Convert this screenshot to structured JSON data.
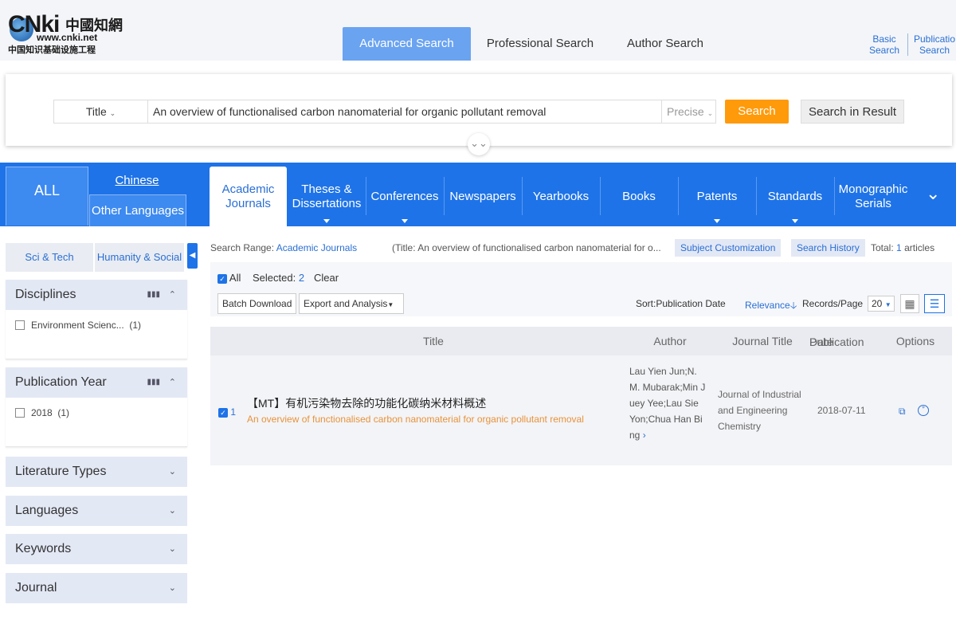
{
  "logo": {
    "brand": "CNki",
    "cn": "中國知網",
    "url": "www.cnki.net",
    "sub": "中国知识基础设施工程"
  },
  "search_tabs": [
    "Advanced Search",
    "Professional Search",
    "Author Search"
  ],
  "quick_links": [
    {
      "line1": "Basic",
      "line2": "Search"
    },
    {
      "line1": "Publicatio",
      "line2": "Search"
    }
  ],
  "search": {
    "field_type": "Title",
    "query": "An overview of functionalised carbon nanomaterial for organic pollutant removal",
    "match_mode": "Precise",
    "search_label": "Search",
    "search_in_result_label": "Search in Result"
  },
  "nav": {
    "all_label": "ALL",
    "chinese_label": "Chinese",
    "other_label": "Other Languages",
    "tabs": [
      {
        "line1": "Academic",
        "line2": "Journals"
      },
      {
        "line1": "Theses &",
        "line2": "Dissertations"
      },
      {
        "line1": "Conferences",
        "line2": ""
      },
      {
        "line1": "Newspapers",
        "line2": ""
      },
      {
        "line1": "Yearbooks",
        "line2": ""
      },
      {
        "line1": "Books",
        "line2": ""
      },
      {
        "line1": "Patents",
        "line2": ""
      },
      {
        "line1": "Standards",
        "line2": ""
      },
      {
        "line1": "Monographic",
        "line2": "Serials"
      }
    ]
  },
  "sidebar": {
    "segments": [
      "Sci & Tech",
      "Humanity & Social"
    ],
    "disciplines": {
      "title": "Disciplines",
      "items": [
        {
          "label": "Environment Scienc...",
          "count": "(1)"
        }
      ]
    },
    "pub_year": {
      "title": "Publication Year",
      "items": [
        {
          "label": "2018",
          "count": "(1)"
        }
      ]
    },
    "groups": [
      "Literature Types",
      "Languages",
      "Keywords",
      "Journal"
    ]
  },
  "results": {
    "range_label": "Search Range:",
    "range_value": "Academic Journals",
    "query_summary": "(Title:  An overview of functionalised carbon nanomaterial for o...",
    "subject_custom": "Subject Customization",
    "search_history": "Search History",
    "total_label": "Total:",
    "total_count": "1",
    "articles_label": "articles",
    "all_label": "All",
    "selected_label": "Selected:",
    "selected_count": "2",
    "clear_label": "Clear",
    "batch_download": "Batch Download",
    "export_analysis": "Export and Analysis",
    "sort_label": "Sort:",
    "sort_pub_date": "Publication Date",
    "sort_relevance": "Relevance",
    "records_label": "Records/Page",
    "records_value": "20",
    "columns": {
      "title": "Title",
      "author": "Author",
      "journal": "Journal Title",
      "pubdate_line1": "Publication",
      "pubdate_line2": "Date",
      "options": "Options"
    },
    "rows": [
      {
        "index": "1",
        "title_cn": "【MT】有机污染物去除的功能化碳纳米材料概述",
        "title_en": "An overview of functionalised carbon nanomaterial for organic pollutant removal",
        "authors": "Lau Yien Jun;N.M. Mubarak;Min Juey Yee;Lau Sie Yon;Chua Han Bing",
        "journal": "Journal of Industrial and Engineering Chemistry",
        "pub_date": "2018-07-11"
      }
    ]
  }
}
